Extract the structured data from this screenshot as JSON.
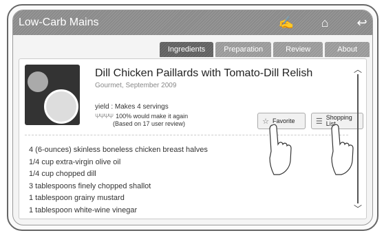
{
  "app": {
    "title": "Low-Carb Mains"
  },
  "titlebar_icons": [
    {
      "name": "notes-icon",
      "glyph": "✍"
    },
    {
      "name": "home-icon",
      "glyph": "⌂"
    },
    {
      "name": "back-icon",
      "glyph": "↩"
    }
  ],
  "tabs": [
    {
      "label": "Ingredients",
      "active": true
    },
    {
      "label": "Preparation",
      "active": false
    },
    {
      "label": "Review",
      "active": false
    },
    {
      "label": "About",
      "active": false
    }
  ],
  "recipe": {
    "title": "Dill Chicken Paillards with Tomato-Dill Relish",
    "source": "Gourmet, September 2009",
    "yield": "yield : Makes 4 servings",
    "rating_line1": "100% would make it again",
    "rating_line2": "(Based on 17 user review)"
  },
  "buttons": {
    "favorite": "Favorite",
    "shopping": "Shopping List"
  },
  "ingredients": [
    "4 (6-ounces) skinless boneless chicken breast halves",
    "1/4 cup extra-virgin olive oil",
    "1/4 cup chopped dill",
    "3 tablespoons finely chopped shallot",
    "1 tablespoon grainy mustard",
    "1 tablespoon white-wine vinegar"
  ]
}
